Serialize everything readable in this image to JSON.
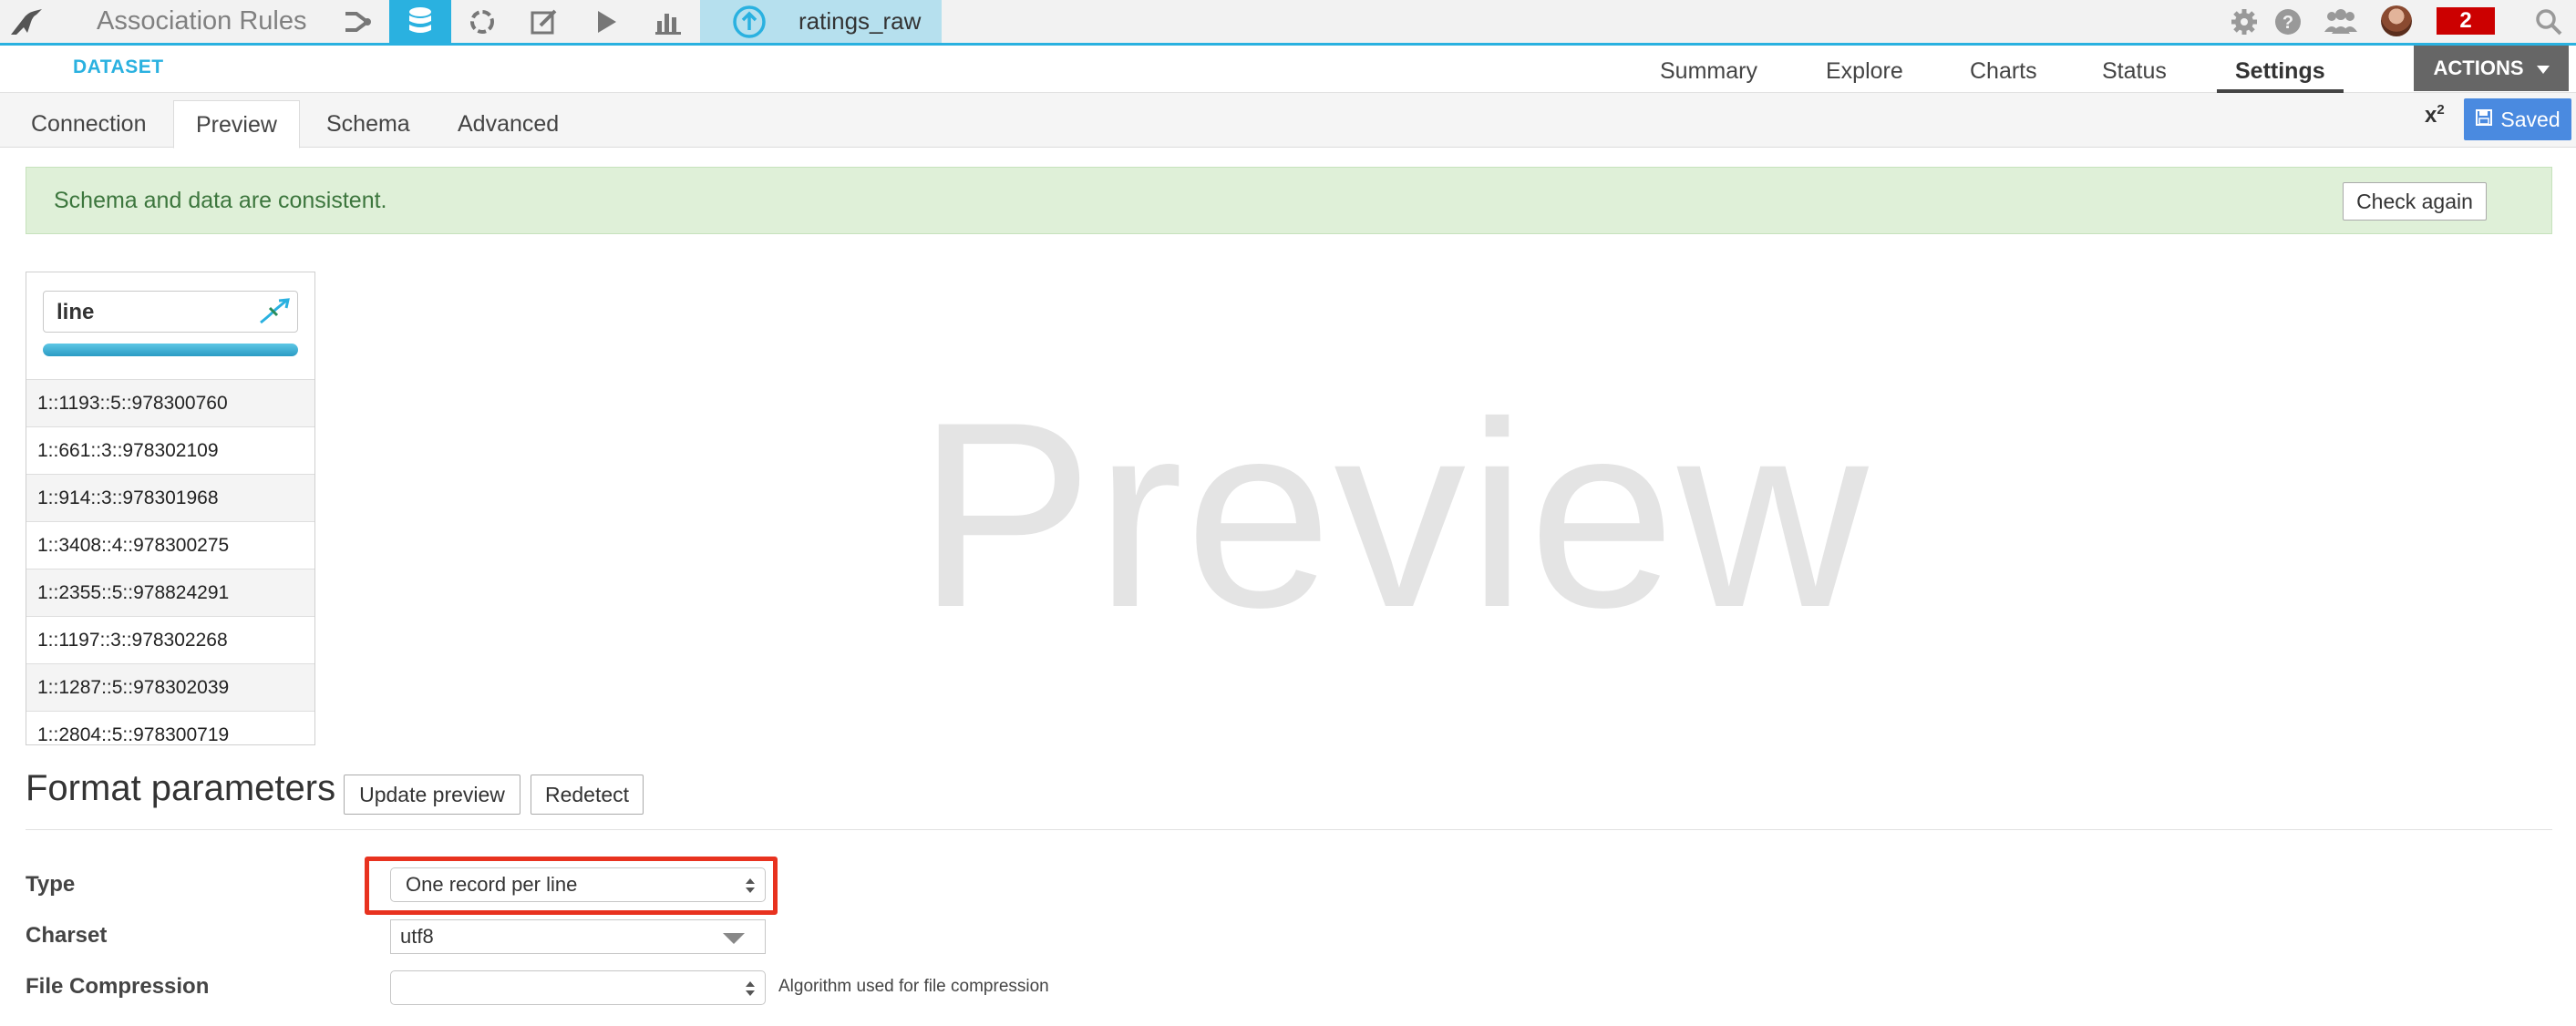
{
  "topbar": {
    "project_title": "Association Rules",
    "dataset_name": "ratings_raw",
    "notifications_count": "2",
    "nav_icons": [
      "flow-icon",
      "datasets-icon",
      "recipes-icon",
      "notebooks-icon",
      "jobs-icon",
      "dashboards-icon"
    ],
    "accent_color": "#2ab1e0"
  },
  "subbar": {
    "section_label": "DATASET",
    "tabs": [
      "Summary",
      "Explore",
      "Charts",
      "Status",
      "Settings"
    ],
    "active_tab": "Settings",
    "actions_label": "ACTIONS"
  },
  "settings": {
    "tabs": [
      "Connection",
      "Preview",
      "Schema",
      "Advanced"
    ],
    "active_tab": "Preview",
    "x2_label": "x",
    "x2_sup": "2",
    "saved_label": "Saved"
  },
  "alert": {
    "message": "Schema and data are consistent.",
    "check_again_label": "Check again"
  },
  "preview": {
    "column_name": "line",
    "rows": [
      "1::1193::5::978300760",
      "1::661::3::978302109",
      "1::914::3::978301968",
      "1::3408::4::978300275",
      "1::2355::5::978824291",
      "1::1197::3::978302268",
      "1::1287::5::978302039",
      "1::2804::5::978300719"
    ],
    "watermark": "Preview"
  },
  "format": {
    "title": "Format parameters",
    "update_preview_label": "Update preview",
    "redetect_label": "Redetect",
    "type_label": "Type",
    "type_value": "One record per line",
    "charset_label": "Charset",
    "charset_value": "utf8",
    "compression_label": "File Compression",
    "compression_value": "",
    "compression_help": "Algorithm used for file compression"
  }
}
